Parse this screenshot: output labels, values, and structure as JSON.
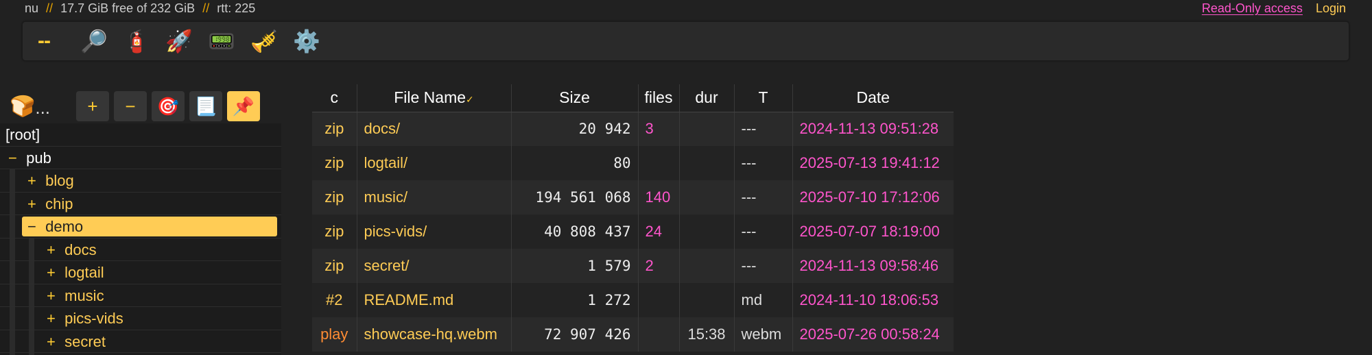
{
  "status": {
    "host": "nu",
    "sep": "//",
    "disk": "17.7 GiB free of 232 GiB",
    "rtt": "rtt: 225"
  },
  "account": {
    "readonly_label": "Read-Only access",
    "login_label": "Login"
  },
  "toolbar": {
    "dash": "--",
    "search": "🔎",
    "unpost": "🧯",
    "upload": "🚀",
    "media": "📟",
    "announce": "🎺",
    "settings": "⚙️"
  },
  "tree_controls": {
    "logo": "🍞",
    "logo_dots": "...",
    "plus": "+",
    "minus": "−",
    "target": "🎯",
    "scroll": "📃",
    "pin": "📌"
  },
  "tree": [
    {
      "sign": "",
      "label": "[root]"
    },
    {
      "sign": "−",
      "label": "pub"
    },
    {
      "sign": "+",
      "label": "blog"
    },
    {
      "sign": "+",
      "label": "chip"
    },
    {
      "sign": "−",
      "label": "demo"
    },
    {
      "sign": "+",
      "label": "docs"
    },
    {
      "sign": "+",
      "label": "logtail"
    },
    {
      "sign": "+",
      "label": "music"
    },
    {
      "sign": "+",
      "label": "pics-vids"
    },
    {
      "sign": "+",
      "label": "secret"
    }
  ],
  "table": {
    "headers": {
      "c": "c",
      "name": "File Name",
      "sort": "✓",
      "size": "Size",
      "files": "files",
      "dur": "dur",
      "type": "T",
      "date": "Date"
    },
    "rows": [
      {
        "act": "zip",
        "name": "docs/",
        "size": "20 942",
        "files": "3",
        "dur": "",
        "type": "---",
        "date": "2024-11-13 09:51:28"
      },
      {
        "act": "zip",
        "name": "logtail/",
        "size": "80",
        "files": "",
        "dur": "",
        "type": "---",
        "date": "2025-07-13 19:41:12"
      },
      {
        "act": "zip",
        "name": "music/",
        "size": "194 561 068",
        "files": "140",
        "dur": "",
        "type": "---",
        "date": "2025-07-10 17:12:06"
      },
      {
        "act": "zip",
        "name": "pics-vids/",
        "size": "40 808 437",
        "files": "24",
        "dur": "",
        "type": "---",
        "date": "2025-07-07 18:19:00"
      },
      {
        "act": "zip",
        "name": "secret/",
        "size": "1 579",
        "files": "2",
        "dur": "",
        "type": "---",
        "date": "2024-11-13 09:58:46"
      },
      {
        "act": "#2",
        "name": "README.md",
        "size": "1 272",
        "files": "",
        "dur": "",
        "type": "md",
        "date": "2024-11-10 18:06:53"
      },
      {
        "act": "play",
        "name": "showcase-hq.webm",
        "size": "72 907 426",
        "files": "",
        "dur": "15:38",
        "type": "webm",
        "date": "2025-07-26 00:58:24"
      }
    ]
  }
}
